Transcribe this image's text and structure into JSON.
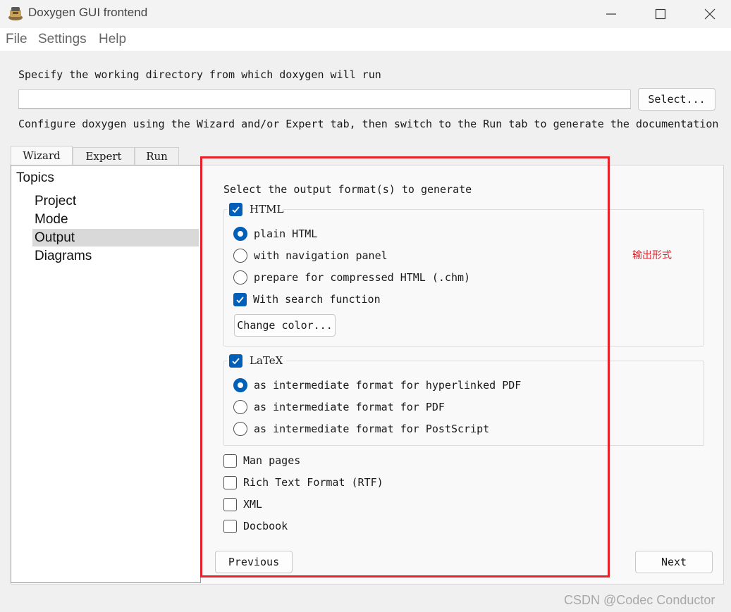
{
  "window": {
    "title": "Doxygen GUI frontend"
  },
  "menu": [
    "File",
    "Settings",
    "Help"
  ],
  "working_dir": {
    "prompt": "Specify the working directory from which doxygen will run",
    "value": "",
    "select_label": "Select..."
  },
  "hint": "Configure doxygen using the Wizard and/or Expert tab, then switch to the Run tab to generate the documentation",
  "tabs": [
    "Wizard",
    "Expert",
    "Run"
  ],
  "topics": {
    "title": "Topics",
    "items": [
      "Project",
      "Mode",
      "Output",
      "Diagrams"
    ],
    "selected": "Output"
  },
  "output": {
    "heading": "Select the output format(s) to generate",
    "html": {
      "label": "HTML",
      "checked": true,
      "options": [
        "plain HTML",
        "with navigation panel",
        "prepare for compressed HTML (.chm)"
      ],
      "selected_option": "plain HTML",
      "search_label": "With search function",
      "search_checked": true,
      "color_button": "Change color..."
    },
    "latex": {
      "label": "LaTeX",
      "checked": true,
      "options": [
        "as intermediate format for hyperlinked PDF",
        "as intermediate format for PDF",
        "as intermediate format for PostScript"
      ],
      "selected_option": "as intermediate format for hyperlinked PDF"
    },
    "others": [
      {
        "label": "Man pages",
        "checked": false
      },
      {
        "label": "Rich Text Format (RTF)",
        "checked": false
      },
      {
        "label": "XML",
        "checked": false
      },
      {
        "label": "Docbook",
        "checked": false
      }
    ]
  },
  "nav": {
    "previous": "Previous",
    "next": "Next"
  },
  "annotation": "输出形式",
  "watermark": "CSDN @Codec Conductor",
  "colors": {
    "accent": "#005fb8",
    "highlight_border": "#e8202a"
  }
}
